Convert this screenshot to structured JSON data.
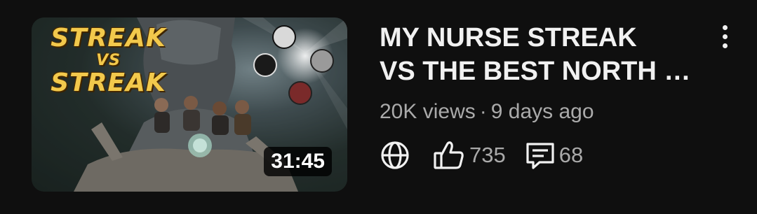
{
  "video": {
    "title_line1": "MY NURSE STREAK",
    "title_line2": "VS THE BEST NORTH …",
    "views": "20K views",
    "separator": "·",
    "age": "9 days ago",
    "likes": "735",
    "comments": "68",
    "duration": "31:45"
  },
  "thumbnail": {
    "text_line1": "STREAK",
    "text_line2": "VS",
    "text_line3": "STREAK"
  },
  "icons": {
    "visibility": "globe-icon",
    "likes": "thumbs-up-icon",
    "comments": "comment-icon",
    "menu": "more-vert-icon"
  },
  "colors": {
    "background": "#0f0f0f",
    "title": "#f1f1f1",
    "meta": "#aaaaaa",
    "thumbnail_text": "#f2c94c"
  }
}
